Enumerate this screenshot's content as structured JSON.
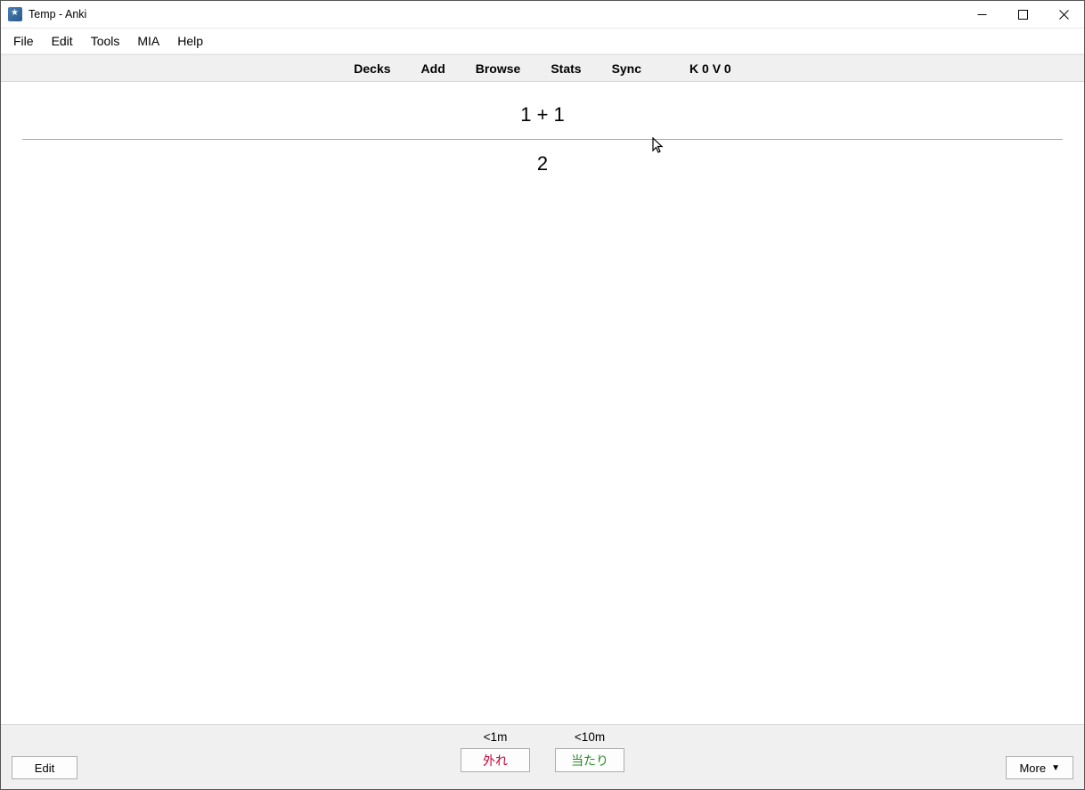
{
  "window": {
    "title": "Temp - Anki"
  },
  "menu": {
    "items": [
      "File",
      "Edit",
      "Tools",
      "MIA",
      "Help"
    ]
  },
  "toolbar": {
    "decks": "Decks",
    "add": "Add",
    "browse": "Browse",
    "stats": "Stats",
    "sync": "Sync",
    "counter": "K 0 V 0"
  },
  "card": {
    "question": "1 + 1",
    "answer": "2"
  },
  "bottom": {
    "edit": "Edit",
    "more": "More",
    "again_time": "<1m",
    "again_label": "外れ",
    "good_time": "<10m",
    "good_label": "当たり"
  }
}
